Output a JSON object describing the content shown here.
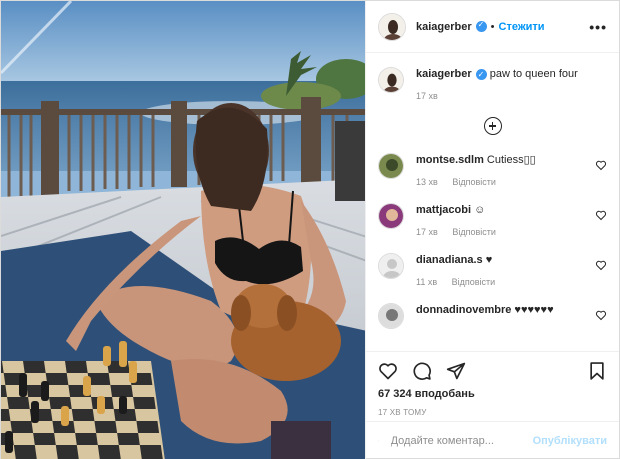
{
  "post": {
    "author": "kaiagerber",
    "follow_label": "Стежити",
    "dot": "•",
    "more_icon": "more-horizontal-icon",
    "caption": "paw to queen four",
    "caption_time": "17 хв"
  },
  "comments": [
    {
      "user": "montse.sdlm",
      "text": "Cutiess▯▯",
      "time": "13 хв",
      "reply": "Відповісти"
    },
    {
      "user": "mattjacobi",
      "text": "☺",
      "time": "17 хв",
      "reply": "Відповісти"
    },
    {
      "user": "dianadiana.s",
      "text": "♥",
      "time": "11 хв",
      "reply": "Відповісти"
    },
    {
      "user": "donnadinovembre",
      "text": "♥♥♥♥♥♥",
      "time": "",
      "reply": ""
    }
  ],
  "actions": {
    "likes": "67 324 вподобань",
    "timestamp": "17 ХВ ТОМУ"
  },
  "add_comment": {
    "placeholder": "Додайте коментар...",
    "publish_label": "Опублікувати"
  },
  "colors": {
    "accent": "#0095f6",
    "verified": "#3897f0",
    "publish_disabled": "#b2dffc",
    "muted": "#8e8e8e"
  }
}
